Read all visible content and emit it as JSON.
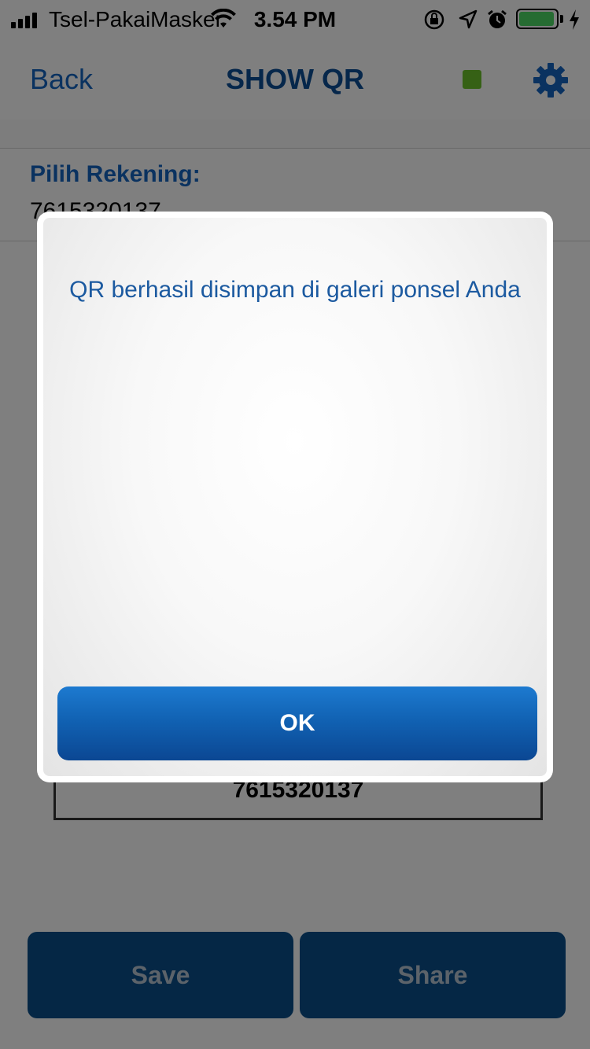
{
  "status_bar": {
    "carrier": "Tsel-PakaiMasker",
    "time": "3.54 PM",
    "icons": [
      "signal-icon",
      "wifi-icon",
      "orientation-lock-icon",
      "location-icon",
      "alarm-icon",
      "battery-icon",
      "charging-icon"
    ]
  },
  "nav": {
    "back_label": "Back",
    "title": "SHOW QR",
    "status_color": "#6cc32a",
    "settings_icon": "gear-icon"
  },
  "account": {
    "label": "Pilih Rekening:",
    "number": "7615320137"
  },
  "qr": {
    "number": "7615320137"
  },
  "actions": {
    "save_label": "Save",
    "share_label": "Share"
  },
  "dialog": {
    "message": "QR berhasil disimpan di galeri ponsel Anda",
    "ok_label": "OK"
  },
  "colors": {
    "accent": "#1565c0",
    "button_dark": "#0a4f8a"
  }
}
